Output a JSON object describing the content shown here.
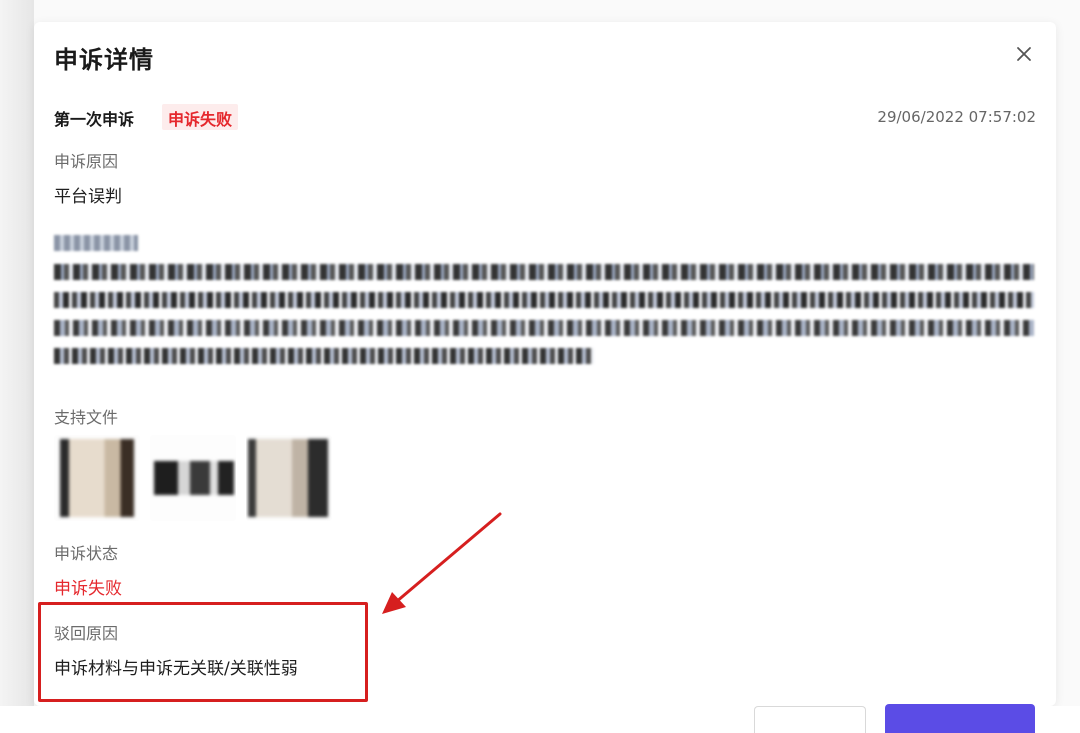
{
  "dialog": {
    "title": "申诉详情",
    "close_icon": "close-icon"
  },
  "appeal": {
    "round": "第一次申诉",
    "status_badge": "申诉失败",
    "timestamp": "29/06/2022 07:57:02"
  },
  "fields": {
    "reason_label": "申诉原因",
    "reason_value": "平台误判",
    "files_label": "支持文件",
    "status_label": "申诉状态",
    "status_value": "申诉失败",
    "reject_label": "驳回原因",
    "reject_value": "申诉材料与申诉无关联/关联性弱"
  },
  "colors": {
    "fail_red": "#e5282d",
    "annotation_red": "#d61f1f",
    "primary_button": "#5b4ce6"
  }
}
